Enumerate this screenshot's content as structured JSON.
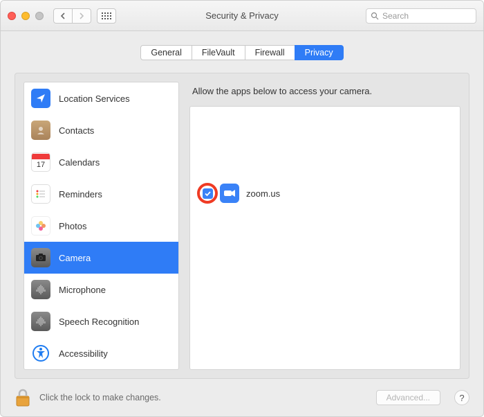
{
  "window_title": "Security & Privacy",
  "search": {
    "placeholder": "Search"
  },
  "tabs": [
    {
      "label": "General"
    },
    {
      "label": "FileVault"
    },
    {
      "label": "Firewall"
    },
    {
      "label": "Privacy"
    }
  ],
  "sidebar": {
    "items": [
      {
        "label": "Location Services",
        "icon": "location"
      },
      {
        "label": "Contacts",
        "icon": "contacts"
      },
      {
        "label": "Calendars",
        "icon": "calendar",
        "badge": "17"
      },
      {
        "label": "Reminders",
        "icon": "reminders"
      },
      {
        "label": "Photos",
        "icon": "photos"
      },
      {
        "label": "Camera",
        "icon": "camera"
      },
      {
        "label": "Microphone",
        "icon": "microphone"
      },
      {
        "label": "Speech Recognition",
        "icon": "speech"
      },
      {
        "label": "Accessibility",
        "icon": "accessibility"
      }
    ]
  },
  "pane": {
    "title": "Allow the apps below to access your camera.",
    "apps": [
      {
        "name": "zoom.us",
        "checked": true,
        "icon": "video"
      }
    ]
  },
  "footer": {
    "lock_text": "Click the lock to make changes.",
    "advanced": "Advanced...",
    "help": "?"
  }
}
